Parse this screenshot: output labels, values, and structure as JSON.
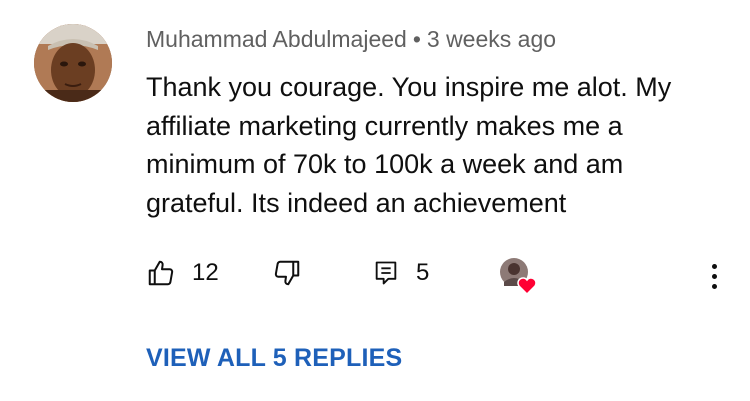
{
  "comment": {
    "author": "Muhammad Abdulmajeed",
    "separator": "•",
    "time_ago": "3 weeks ago",
    "lines": [
      "Thank you courage. You inspire me alot. My",
      "affiliate marketing currently makes me a",
      "minimum of 70k to 100k a week and am",
      "grateful. Its indeed an achievement"
    ]
  },
  "actions": {
    "like_icon": "thumbs-up-icon",
    "like_count": "12",
    "dislike_icon": "thumbs-down-icon",
    "reply_icon": "reply-comment-icon",
    "reply_count": "5",
    "creator_heart_icon": "creator-heart-icon",
    "more_icon": "more-vertical-icon"
  },
  "replies": {
    "view_all_label": "VIEW ALL 5 REPLIES"
  },
  "colors": {
    "link": "#1e60b9",
    "meta_text": "#606060",
    "heart": "#ff0033"
  }
}
